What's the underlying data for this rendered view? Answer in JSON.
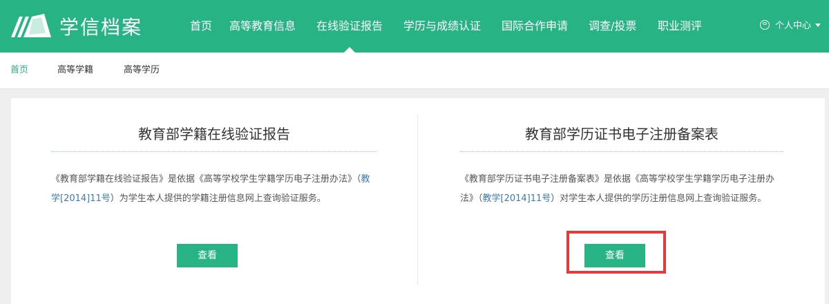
{
  "colors": {
    "brand": "#27b383",
    "link": "#3a7ab8",
    "highlight": "#e43a3a"
  },
  "header": {
    "logo_icon": "book-logo-icon",
    "brand": "学信档案",
    "nav": [
      "首页",
      "高等教育信息",
      "在线验证报告",
      "学历与成绩认证",
      "国际合作申请",
      "调查/投票",
      "职业测评"
    ],
    "active_nav": "在线验证报告",
    "user_menu": "个人中心",
    "user_icon": "user-circle-icon"
  },
  "breadcrumb": [
    "首页",
    "高等学籍",
    "高等学历"
  ],
  "panels": [
    {
      "title": "教育部学籍在线验证报告",
      "desc_before": "《教育部学籍在线验证报告》是依据《高等学校学生学籍学历电子注册办法》（",
      "desc_link": "教学[2014]11号",
      "desc_after": "）为学生本人提供的学籍注册信息网上查询验证服务。",
      "button": "查看"
    },
    {
      "title": "教育部学历证书电子注册备案表",
      "desc_before": "《教育部学历证书电子注册备案表》是依据《高等学校学生学籍学历电子注册办法》（",
      "desc_link": "教学[2014]11号",
      "desc_after": "）对学生本人提供的学历注册信息网上查询验证服务。",
      "button": "查看"
    }
  ]
}
